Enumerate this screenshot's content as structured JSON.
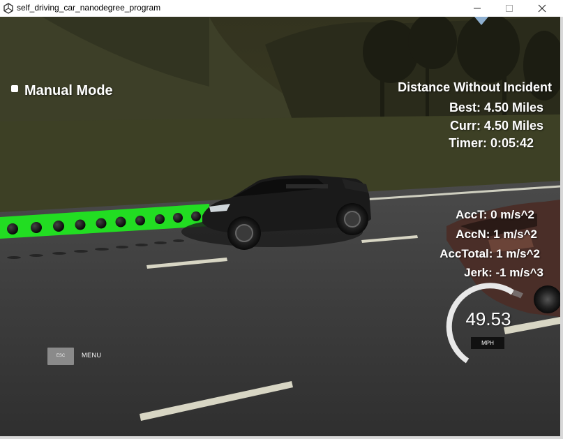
{
  "window": {
    "title": "self_driving_car_nanodegree_program",
    "controls": [
      "minimize-icon",
      "maximize-icon",
      "close-icon"
    ]
  },
  "hud": {
    "mode_label": "Manual Mode",
    "distance_title": "Distance Without Incident",
    "best": "Best: 4.50 Miles",
    "curr": "Curr: 4.50 Miles",
    "timer": "Timer: 0:05:42",
    "acc_t": "AccT: 0 m/s^2",
    "acc_n": "AccN: 1 m/s^2",
    "acc_total": "AccTotal: 1 m/s^2",
    "jerk": "Jerk: -1 m/s^3"
  },
  "speedometer": {
    "value": "49.53",
    "unit": "MPH"
  },
  "menu": {
    "esc_key": "ESC",
    "label": "MENU"
  },
  "colors": {
    "path_points": "#22dd22",
    "road": "#3d3d3d",
    "grass": "#3a3d22",
    "hud_text": "#ffffff"
  }
}
